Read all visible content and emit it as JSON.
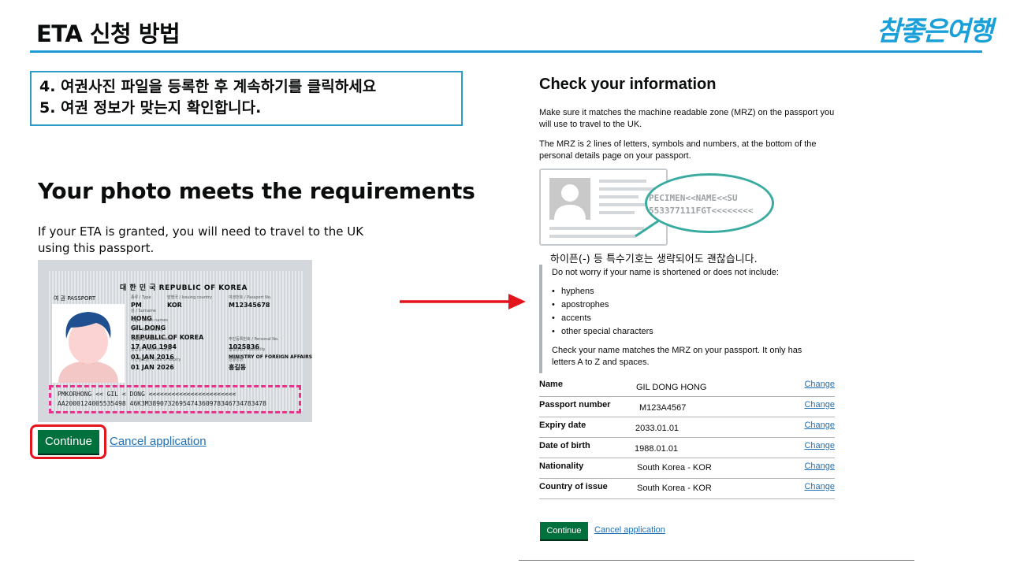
{
  "slide": {
    "title": "ETA 신청 방법",
    "brand": "참좋은여행",
    "steps": [
      "4. 여권사진 파일을 등록한 후 계속하기를 클릭하세요",
      "5. 여권 정보가 맞는지 확인합니다."
    ],
    "korean_note": "하이픈(-) 등 특수기호는 생략되어도 괜찮습니다."
  },
  "photo_page": {
    "heading": "Your photo meets the requirements",
    "text": "If your ETA is granted, you will need to travel to the UK using this passport.",
    "continue_label": "Continue",
    "cancel_label": "Cancel application"
  },
  "passport_image": {
    "title": "대 한 민 국   REPUBLIC OF KOREA",
    "kind": "여 권  PASSPORT",
    "type_caption": "종류 / Type",
    "type": "PM",
    "country_caption": "발행국 / Issuing country",
    "country": "KOR",
    "number_caption": "여권번호 / Passport No.",
    "number": "M12345678",
    "surname_caption": "성 / Surname",
    "surname": "HONG",
    "given_caption": "이름 / Given names",
    "given": "GIL DONG",
    "nationality_caption": "국적 / Nationality",
    "nationality": "REPUBLIC OF KOREA",
    "dob_caption": "생년월일 / Date of birth",
    "dob": "17 AUG 1984",
    "personal_caption": "주민등록번호 / Personal No.",
    "personal": "1025836",
    "issue_caption": "발급일 / Date of issue",
    "issue": "01 JAN 2016",
    "authority_caption": "발행관청 / Authority",
    "authority": "MINISTRY OF FOREIGN AFFAIRS",
    "expiry_caption": "기간만료일 / Date of expiry",
    "expiry": "01 JAN 2026",
    "korean_name_caption": "한글성명",
    "korean_name": "홍길동",
    "mrz_line1": "PMKORHONG << GIL <  DONG <<<<<<<<<<<<<<<<<<<<<<<",
    "mrz_line2": "AA2000124005535498 46K3M3890732695474360978346734783478"
  },
  "check_page": {
    "heading": "Check your information",
    "para1": "Make sure it matches the machine readable zone (MRZ) on the passport you will use to travel to the UK.",
    "para2": "The MRZ is 2 lines of letters, symbols and numbers, at the bottom of the personal details page on your passport.",
    "mrz_sample1": "PECIMEN<<NAME<<SU",
    "mrz_sample2": "553377111FGT<<<<<<<<",
    "inset_lead": "Do not worry if your name is shortened or does not include:",
    "inset_items": [
      "hyphens",
      "apostrophes",
      "accents",
      "other special characters"
    ],
    "inset_foot": "Check your name matches the MRZ on your passport. It only has letters A to Z and spaces.",
    "summary": [
      {
        "key": "Name",
        "value": "GIL DONG HONG",
        "action": "Change"
      },
      {
        "key": "Passport number",
        "value": "M123A4567",
        "action": "Change"
      },
      {
        "key": "Expiry date",
        "value": "2033.01.01",
        "action": "Change"
      },
      {
        "key": "Date of birth",
        "value": "1988.01.01",
        "action": "Change"
      },
      {
        "key": "Nationality",
        "value": "South Korea - KOR",
        "action": "Change"
      },
      {
        "key": "Country of issue",
        "value": "South Korea - KOR",
        "action": "Change"
      }
    ],
    "continue_label": "Continue",
    "cancel_label": "Cancel application"
  },
  "colors": {
    "accent_blue": "#1d9bd7",
    "gov_green": "#00703c",
    "link_blue": "#1d70b8",
    "highlight_red": "#e3141c",
    "mrz_pink": "#e8338d",
    "magnifier_teal": "#3aaba0"
  },
  "icons": {
    "arrow": "arrow-right-icon",
    "avatar": "person-avatar-icon"
  }
}
